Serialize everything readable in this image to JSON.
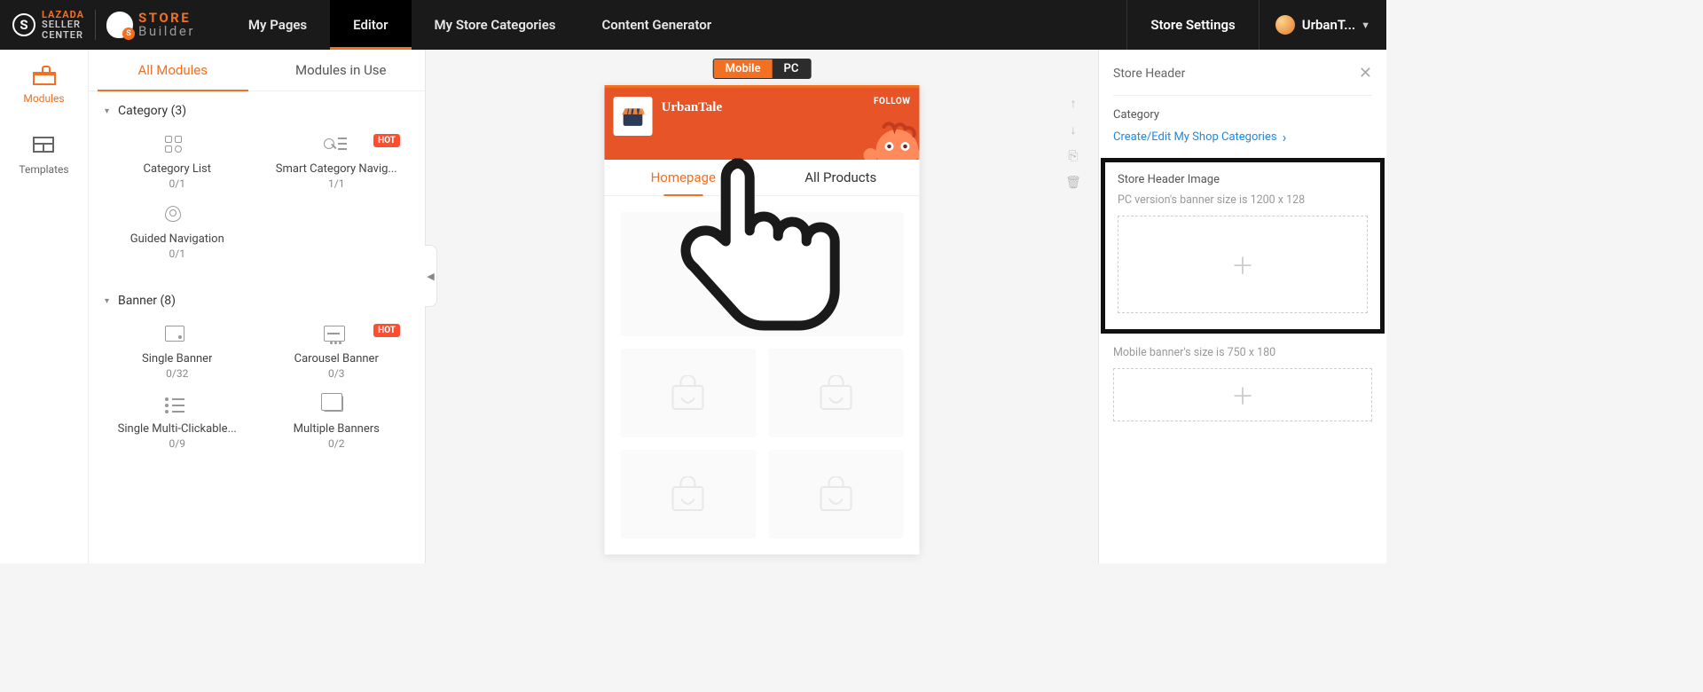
{
  "brand": {
    "lazada_l1": "LAZADA",
    "lazada_l2": "SELLER",
    "lazada_l3": "CENTER",
    "store_l1": "STORE",
    "store_l2": "Builder"
  },
  "nav": {
    "my_pages": "My Pages",
    "editor": "Editor",
    "categories": "My Store Categories",
    "generator": "Content Generator",
    "settings": "Store Settings",
    "user": "UrbanT..."
  },
  "rail": {
    "modules": "Modules",
    "templates": "Templates"
  },
  "tabs": {
    "all": "All Modules",
    "in_use": "Modules in Use"
  },
  "sections": {
    "category": {
      "title": "Category (3)",
      "items": [
        {
          "name": "Category List",
          "count": "0/1",
          "icon": "catlist"
        },
        {
          "name": "Smart Category Navig...",
          "count": "1/1",
          "icon": "smart",
          "hot": "HOT"
        },
        {
          "name": "Guided Navigation",
          "count": "0/1",
          "icon": "pin"
        }
      ]
    },
    "banner": {
      "title": "Banner (8)",
      "items": [
        {
          "name": "Single Banner",
          "count": "0/32",
          "icon": "single"
        },
        {
          "name": "Carousel Banner",
          "count": "0/3",
          "icon": "carousel",
          "hot": "HOT"
        },
        {
          "name": "Single Multi-Clickable...",
          "count": "0/9",
          "icon": "multi"
        },
        {
          "name": "Multiple Banners",
          "count": "0/2",
          "icon": "mult"
        }
      ]
    }
  },
  "device": {
    "mobile": "Mobile",
    "pc": "PC"
  },
  "phone": {
    "store": "UrbanTale",
    "follow": "FOLLOW",
    "tab_home": "Homepage",
    "tab_products": "All Products"
  },
  "props": {
    "title": "Store Header",
    "cat_label": "Category",
    "cat_link": "Create/Edit My Shop Categories",
    "img_label": "Store Header Image",
    "pc_hint": "PC version's banner size is 1200 x 128",
    "mob_hint": "Mobile banner's size is 750 x 180"
  }
}
